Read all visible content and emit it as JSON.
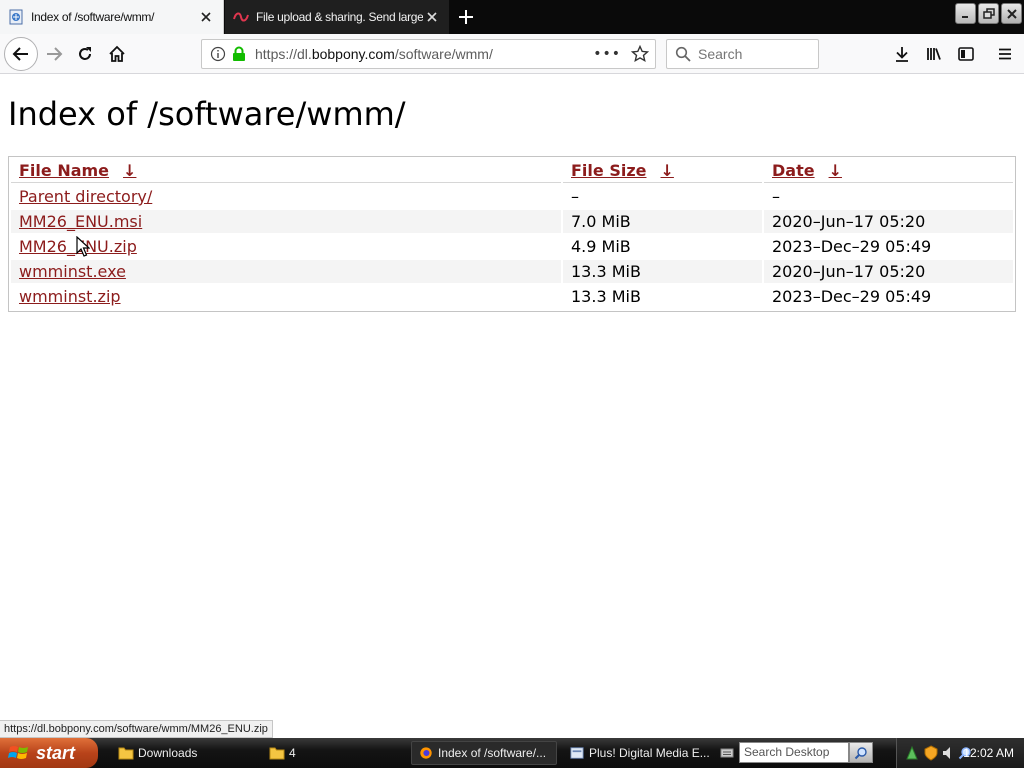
{
  "browser": {
    "tabs": [
      {
        "title": "Index of /software/wmm/",
        "active": true
      },
      {
        "title": "File upload & sharing. Send large p",
        "active": false
      }
    ],
    "url_prefix": "https://dl.",
    "url_domain": "bobpony.com",
    "url_path": "/software/wmm/",
    "search_placeholder": "Search",
    "page_actions": "•••"
  },
  "page": {
    "title": "Index of /software/wmm/",
    "columns": [
      {
        "label": "File Name",
        "sort": "↓"
      },
      {
        "label": "File Size",
        "sort": "↓"
      },
      {
        "label": "Date",
        "sort": "↓"
      }
    ],
    "rows": [
      {
        "name": "Parent directory/",
        "size": "–",
        "date": "–"
      },
      {
        "name": "MM26_ENU.msi",
        "size": "7.0 MiB",
        "date": "2020–Jun–17 05:20"
      },
      {
        "name": "MM26_ENU.zip",
        "size": "4.9 MiB",
        "date": "2023–Dec–29 05:49"
      },
      {
        "name": "wmminst.exe",
        "size": "13.3 MiB",
        "date": "2020–Jun–17 05:20"
      },
      {
        "name": "wmminst.zip",
        "size": "13.3 MiB",
        "date": "2023–Dec–29 05:49"
      }
    ]
  },
  "status": {
    "link_preview": "https://dl.bobpony.com/software/wmm/MM26_ENU.zip"
  },
  "taskbar": {
    "start_label": "start",
    "tasks": [
      {
        "label": "Downloads",
        "icon": "folder-icon"
      },
      {
        "label": "4",
        "icon": "folder-icon"
      },
      {
        "label": "Index of /software/...",
        "icon": "firefox-icon",
        "active": true
      },
      {
        "label": "Plus! Digital Media E...",
        "icon": "installer-icon"
      }
    ],
    "desktop_search_placeholder": "Search Desktop",
    "clock": "12:02 AM"
  },
  "colors": {
    "link": "#8c1c1c",
    "tab_bar": "#0a0a0a",
    "start_button": "#b8431a"
  }
}
